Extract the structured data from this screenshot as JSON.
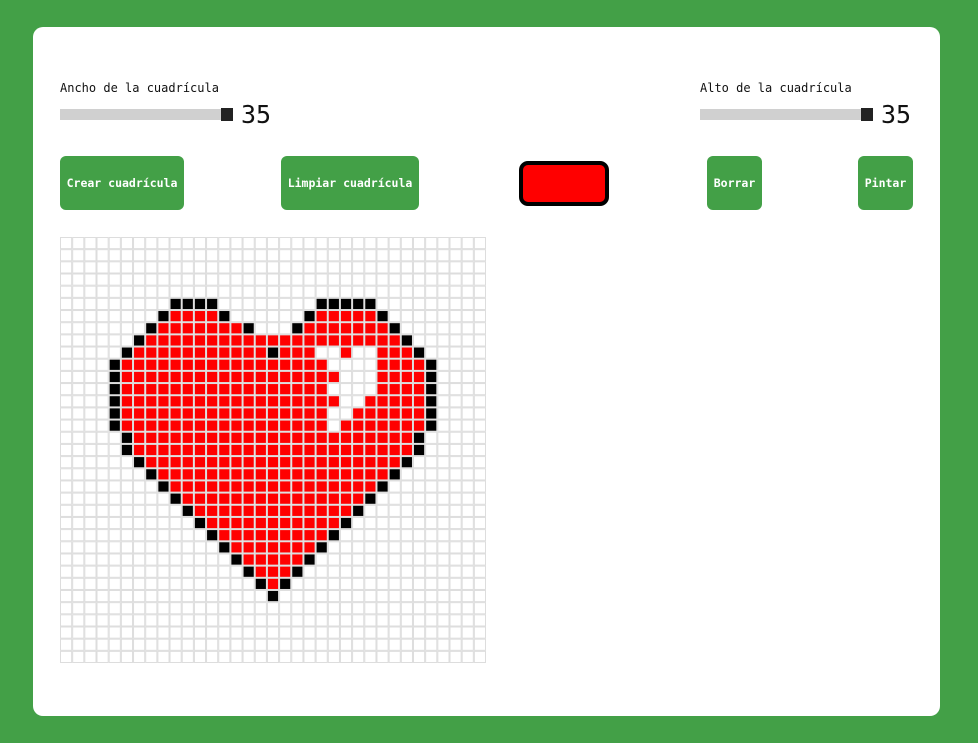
{
  "controls": {
    "width_label": "Ancho de la cuadrícula",
    "width_value": "35",
    "height_label": "Alto de la cuadrícula",
    "height_value": "35",
    "create_button": "Crear cuadrícula",
    "clear_button": "Limpiar cuadrícula",
    "erase_button": "Borrar",
    "paint_button": "Pintar",
    "selected_color": "#ff0000"
  },
  "colors": {
    "accent": "#43a047",
    "grid_line": "#dddddd",
    "red": "#ff0000",
    "black": "#000000"
  },
  "grid": {
    "cols": 35,
    "rows": 35,
    "black_runs": [
      [
        5,
        9,
        12
      ],
      [
        5,
        21,
        25
      ],
      [
        6,
        8,
        8
      ],
      [
        6,
        13,
        13
      ],
      [
        6,
        20,
        20
      ],
      [
        6,
        26,
        26
      ],
      [
        7,
        7,
        7
      ],
      [
        7,
        15,
        15
      ],
      [
        7,
        19,
        19
      ],
      [
        7,
        27,
        27
      ],
      [
        8,
        6,
        6
      ],
      [
        8,
        28,
        28
      ],
      [
        9,
        5,
        5
      ],
      [
        9,
        17,
        17
      ],
      [
        9,
        29,
        29
      ],
      [
        10,
        4,
        4
      ],
      [
        10,
        30,
        30
      ],
      [
        11,
        4,
        4
      ],
      [
        11,
        30,
        30
      ],
      [
        12,
        4,
        4
      ],
      [
        12,
        30,
        30
      ],
      [
        13,
        4,
        4
      ],
      [
        13,
        30,
        30
      ],
      [
        14,
        4,
        4
      ],
      [
        14,
        30,
        30
      ],
      [
        15,
        4,
        4
      ],
      [
        15,
        30,
        30
      ],
      [
        16,
        5,
        5
      ],
      [
        16,
        29,
        29
      ],
      [
        17,
        5,
        5
      ],
      [
        17,
        29,
        29
      ],
      [
        18,
        6,
        6
      ],
      [
        18,
        28,
        28
      ],
      [
        19,
        7,
        7
      ],
      [
        19,
        27,
        27
      ],
      [
        20,
        8,
        8
      ],
      [
        20,
        26,
        26
      ],
      [
        21,
        9,
        9
      ],
      [
        21,
        25,
        25
      ],
      [
        22,
        10,
        10
      ],
      [
        22,
        24,
        24
      ],
      [
        23,
        11,
        11
      ],
      [
        23,
        23,
        23
      ],
      [
        24,
        12,
        12
      ],
      [
        24,
        22,
        22
      ],
      [
        25,
        13,
        13
      ],
      [
        25,
        21,
        21
      ],
      [
        26,
        14,
        14
      ],
      [
        26,
        20,
        20
      ],
      [
        27,
        15,
        15
      ],
      [
        27,
        19,
        19
      ],
      [
        28,
        16,
        16
      ],
      [
        28,
        18,
        18
      ],
      [
        29,
        17,
        17
      ]
    ],
    "red_runs": [
      [
        6,
        9,
        12
      ],
      [
        6,
        21,
        25
      ],
      [
        7,
        8,
        14
      ],
      [
        7,
        20,
        26
      ],
      [
        8,
        7,
        27
      ],
      [
        9,
        6,
        16
      ],
      [
        9,
        18,
        28
      ],
      [
        10,
        5,
        29
      ],
      [
        11,
        5,
        29
      ],
      [
        12,
        5,
        29
      ],
      [
        13,
        5,
        29
      ],
      [
        14,
        5,
        29
      ],
      [
        15,
        5,
        29
      ],
      [
        16,
        6,
        28
      ],
      [
        17,
        6,
        28
      ],
      [
        18,
        7,
        27
      ],
      [
        19,
        8,
        26
      ],
      [
        20,
        9,
        25
      ],
      [
        21,
        10,
        24
      ],
      [
        22,
        11,
        23
      ],
      [
        23,
        12,
        22
      ],
      [
        24,
        13,
        21
      ],
      [
        25,
        14,
        20
      ],
      [
        26,
        15,
        19
      ],
      [
        27,
        16,
        18
      ],
      [
        28,
        17,
        17
      ]
    ],
    "white_runs": [
      [
        9,
        21,
        22
      ],
      [
        9,
        24,
        25
      ],
      [
        10,
        22,
        25
      ],
      [
        11,
        23,
        25
      ],
      [
        12,
        22,
        25
      ],
      [
        13,
        23,
        24
      ],
      [
        14,
        22,
        23
      ],
      [
        15,
        22,
        22
      ]
    ]
  }
}
